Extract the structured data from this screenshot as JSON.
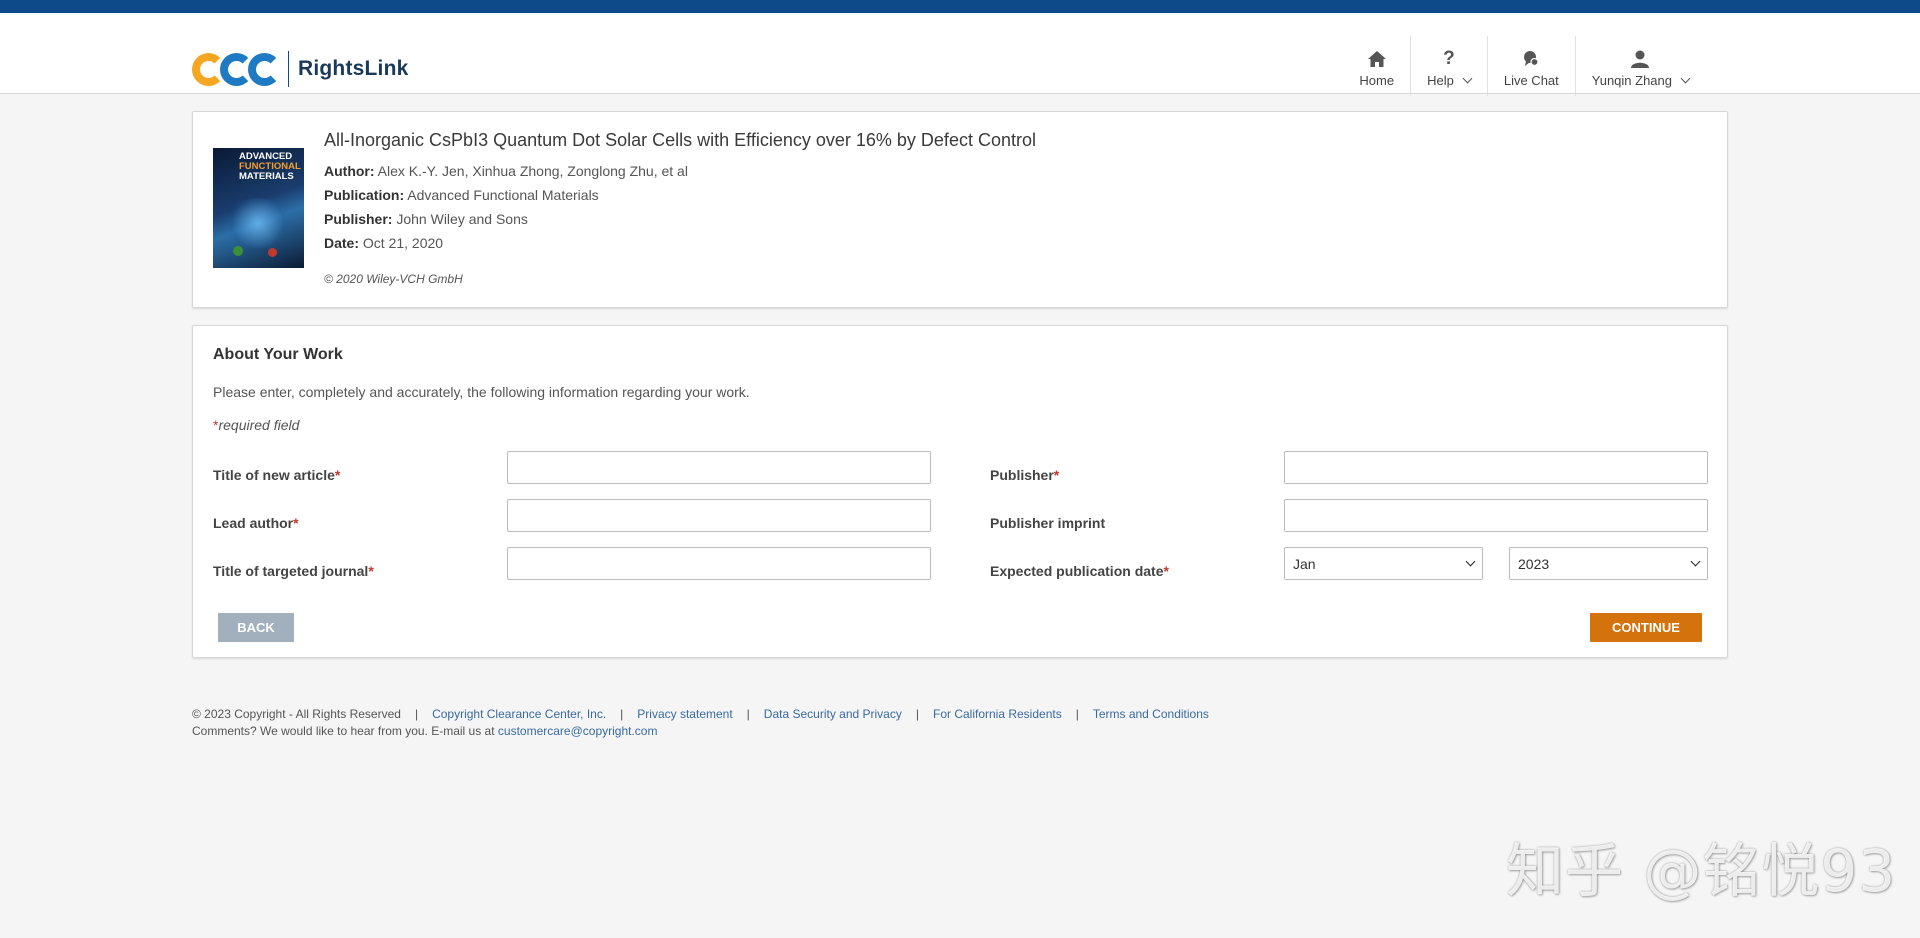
{
  "header": {
    "brand": "RightsLink",
    "nav": [
      {
        "label": "Home",
        "icon": "home-icon"
      },
      {
        "label": "Help",
        "icon": "help-icon"
      },
      {
        "label": "Live Chat",
        "icon": "chat-icon"
      },
      {
        "label": "Yunqin Zhang",
        "icon": "user-icon"
      }
    ]
  },
  "article": {
    "title": "All-Inorganic CsPbI3 Quantum Dot Solar Cells with Efficiency over 16% by Defect Control",
    "author_label": "Author:",
    "author": "Alex K.-Y. Jen, Xinhua Zhong, Zonglong Zhu, et al",
    "publication_label": "Publication:",
    "publication": "Advanced Functional Materials",
    "publisher_label": "Publisher:",
    "publisher": "John Wiley and Sons",
    "date_label": "Date:",
    "date": "Oct 21, 2020",
    "copyright": "© 2020 Wiley-VCH GmbH",
    "cover_line1": "ADVANCED",
    "cover_line2": "FUNCTIONAL",
    "cover_line3": "MATERIALS"
  },
  "work": {
    "title": "About Your Work",
    "intro": "Please enter, completely and accurately, the following information regarding your work.",
    "required_note": "required field",
    "fields": {
      "title_new_article": "Title of new article",
      "lead_author": "Lead author",
      "targeted_journal": "Title of targeted journal",
      "publisher": "Publisher",
      "publisher_imprint": "Publisher imprint",
      "expected_date": "Expected publication date"
    },
    "month_value": "Jan",
    "year_value": "2023",
    "back_label": "BACK",
    "continue_label": "CONTINUE"
  },
  "footer": {
    "copyright": "© 2023 Copyright - All Rights Reserved",
    "links": [
      "Copyright Clearance Center, Inc.",
      "Privacy statement",
      "Data Security and Privacy",
      "For California Residents",
      "Terms and Conditions"
    ],
    "comments": "Comments? We would like to hear from you. E-mail us at",
    "email": "customercare@copyright.com"
  },
  "watermark": "知乎 @铭悦93",
  "colors": {
    "topbar": "#0e4a8a",
    "continue": "#d4720c",
    "back": "#a2afbd",
    "required": "#c0392b"
  }
}
